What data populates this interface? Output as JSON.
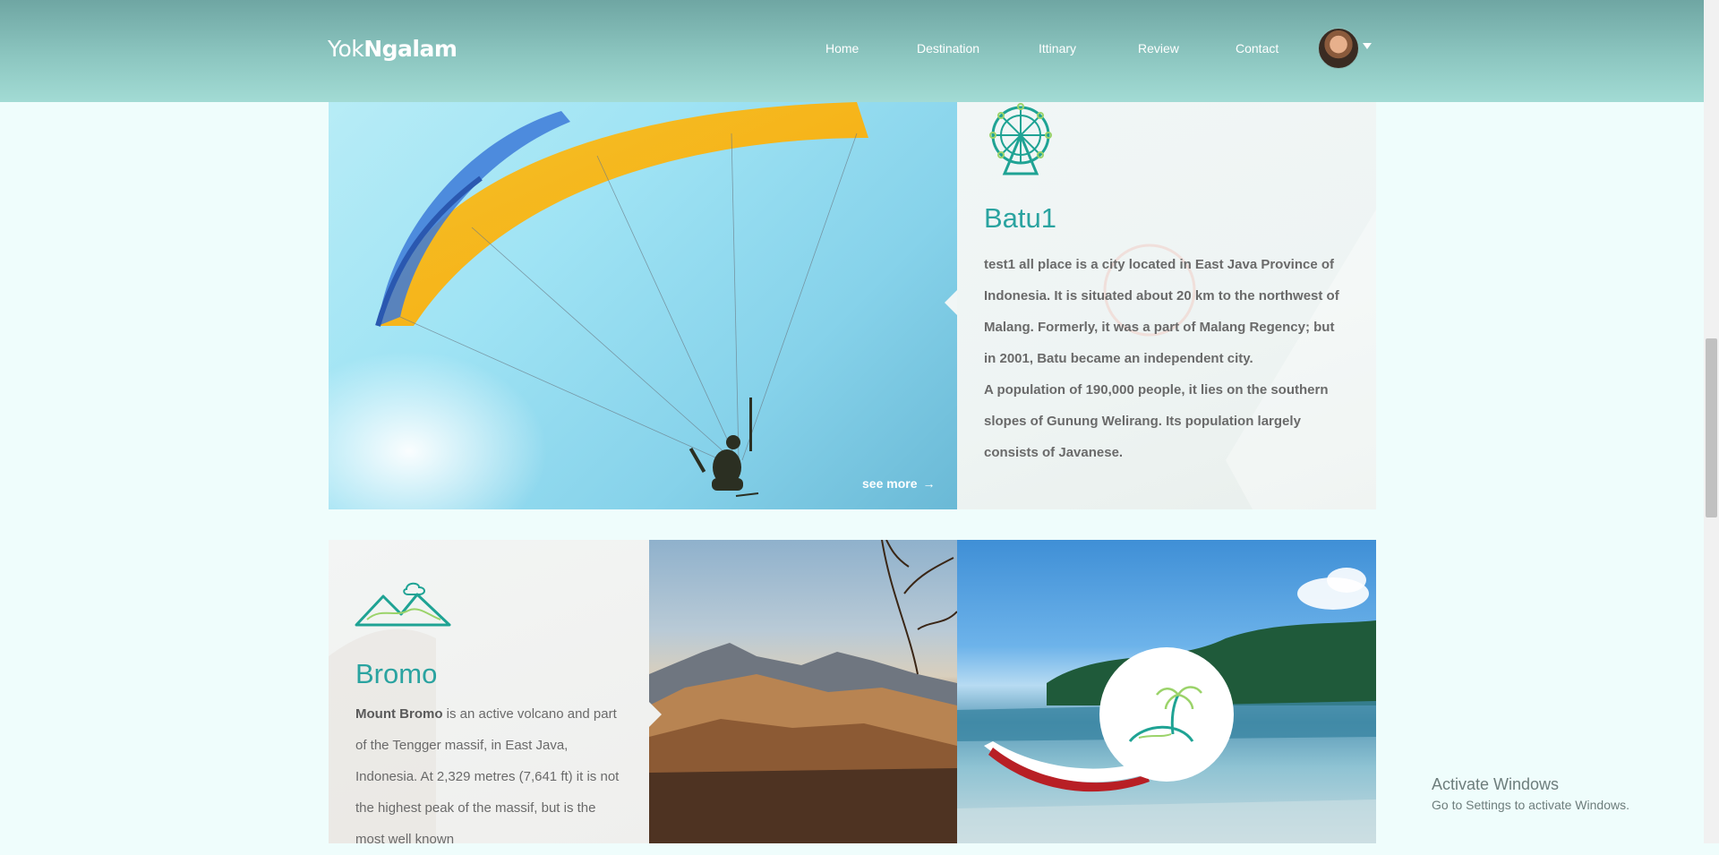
{
  "header": {
    "logo_light": "Yok",
    "logo_bold": "Ngalam",
    "nav": [
      "Home",
      "Destination",
      "Ittinary",
      "Review",
      "Contact"
    ]
  },
  "batu": {
    "icon": "ferris-wheel-icon",
    "title": "Batu1",
    "paragraph1": "test1 all place is a city located in East Java Province of Indonesia. It is situated about 20 km to the northwest of Malang. Formerly, it was a part of Malang Regency; but in 2001, Batu became an independent city.",
    "paragraph2": "A population of 190,000 people, it lies on the southern slopes of Gunung Welirang. Its population largely consists of Javanese.",
    "see_more": "see more"
  },
  "bromo": {
    "icon": "mountain-icon",
    "title": "Bromo",
    "text_bold": "Mount Bromo",
    "text": " is an active volcano and part of the Tengger massif, in East Java, Indonesia. At 2,329 metres (7,641 ft) it is not the highest peak of the massif, but is the most well known"
  },
  "beach": {
    "icon": "palm-island-icon"
  },
  "watermark": {
    "title": "Activate Windows",
    "subtitle": "Go to Settings to activate Windows."
  },
  "colors": {
    "accent": "#2aa3a0",
    "header_top": "#6fa6a3",
    "header_bottom": "#a2dbd4",
    "background": "#effdfc"
  }
}
